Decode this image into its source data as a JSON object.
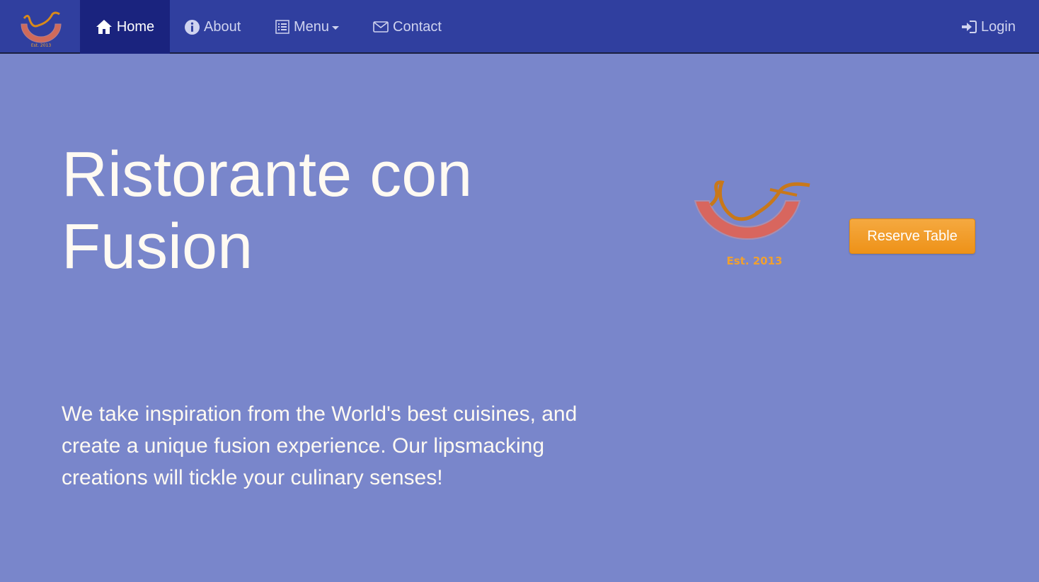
{
  "navbar": {
    "brand_logo_text": "Ristorante con Fusion",
    "brand_logo_est": "Est. 2013",
    "items": [
      {
        "label": "Home",
        "icon": "home-icon",
        "active": true
      },
      {
        "label": "About",
        "icon": "info-circle-icon",
        "active": false
      },
      {
        "label": "Menu",
        "icon": "list-icon",
        "active": false,
        "dropdown": true
      },
      {
        "label": "Contact",
        "icon": "envelope-icon",
        "active": false
      }
    ],
    "login": {
      "label": "Login",
      "icon": "login-icon"
    }
  },
  "hero": {
    "title_line1": "Ristorante con",
    "title_line2": "Fusion",
    "description": "We take inspiration from the World's best cuisines, and create a unique fusion experience. Our lipsmacking creations will tickle your culinary senses!",
    "logo_text": "Ristorante con Fusion",
    "logo_est": "Est. 2013",
    "reserve_button": "Reserve Table"
  },
  "colors": {
    "navbar_bg": "#303f9f",
    "active_nav_bg": "#1a237e",
    "page_bg": "#7986cb",
    "button_accent": "#f0a030"
  }
}
